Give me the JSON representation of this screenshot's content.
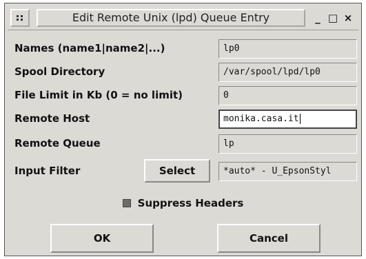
{
  "window": {
    "title": "Edit Remote Unix (lpd) Queue Entry",
    "controls": {
      "minimize": "_",
      "maximize": "□",
      "close": "×"
    }
  },
  "form": {
    "names": {
      "label": "Names (name1|name2|...)",
      "value": "lp0"
    },
    "spool_directory": {
      "label": "Spool Directory",
      "value": "/var/spool/lpd/lp0"
    },
    "file_limit": {
      "label": "File Limit in Kb (0 = no limit)",
      "value": "0"
    },
    "remote_host": {
      "label": "Remote Host",
      "value": "monika.casa.it"
    },
    "remote_queue": {
      "label": "Remote Queue",
      "value": "lp"
    },
    "input_filter": {
      "label": "Input Filter",
      "button_label": "Select",
      "value": "*auto* - U_EpsonStyl"
    },
    "suppress_headers": {
      "label": "Suppress Headers",
      "checked": true
    }
  },
  "buttons": {
    "ok": "OK",
    "cancel": "Cancel"
  }
}
